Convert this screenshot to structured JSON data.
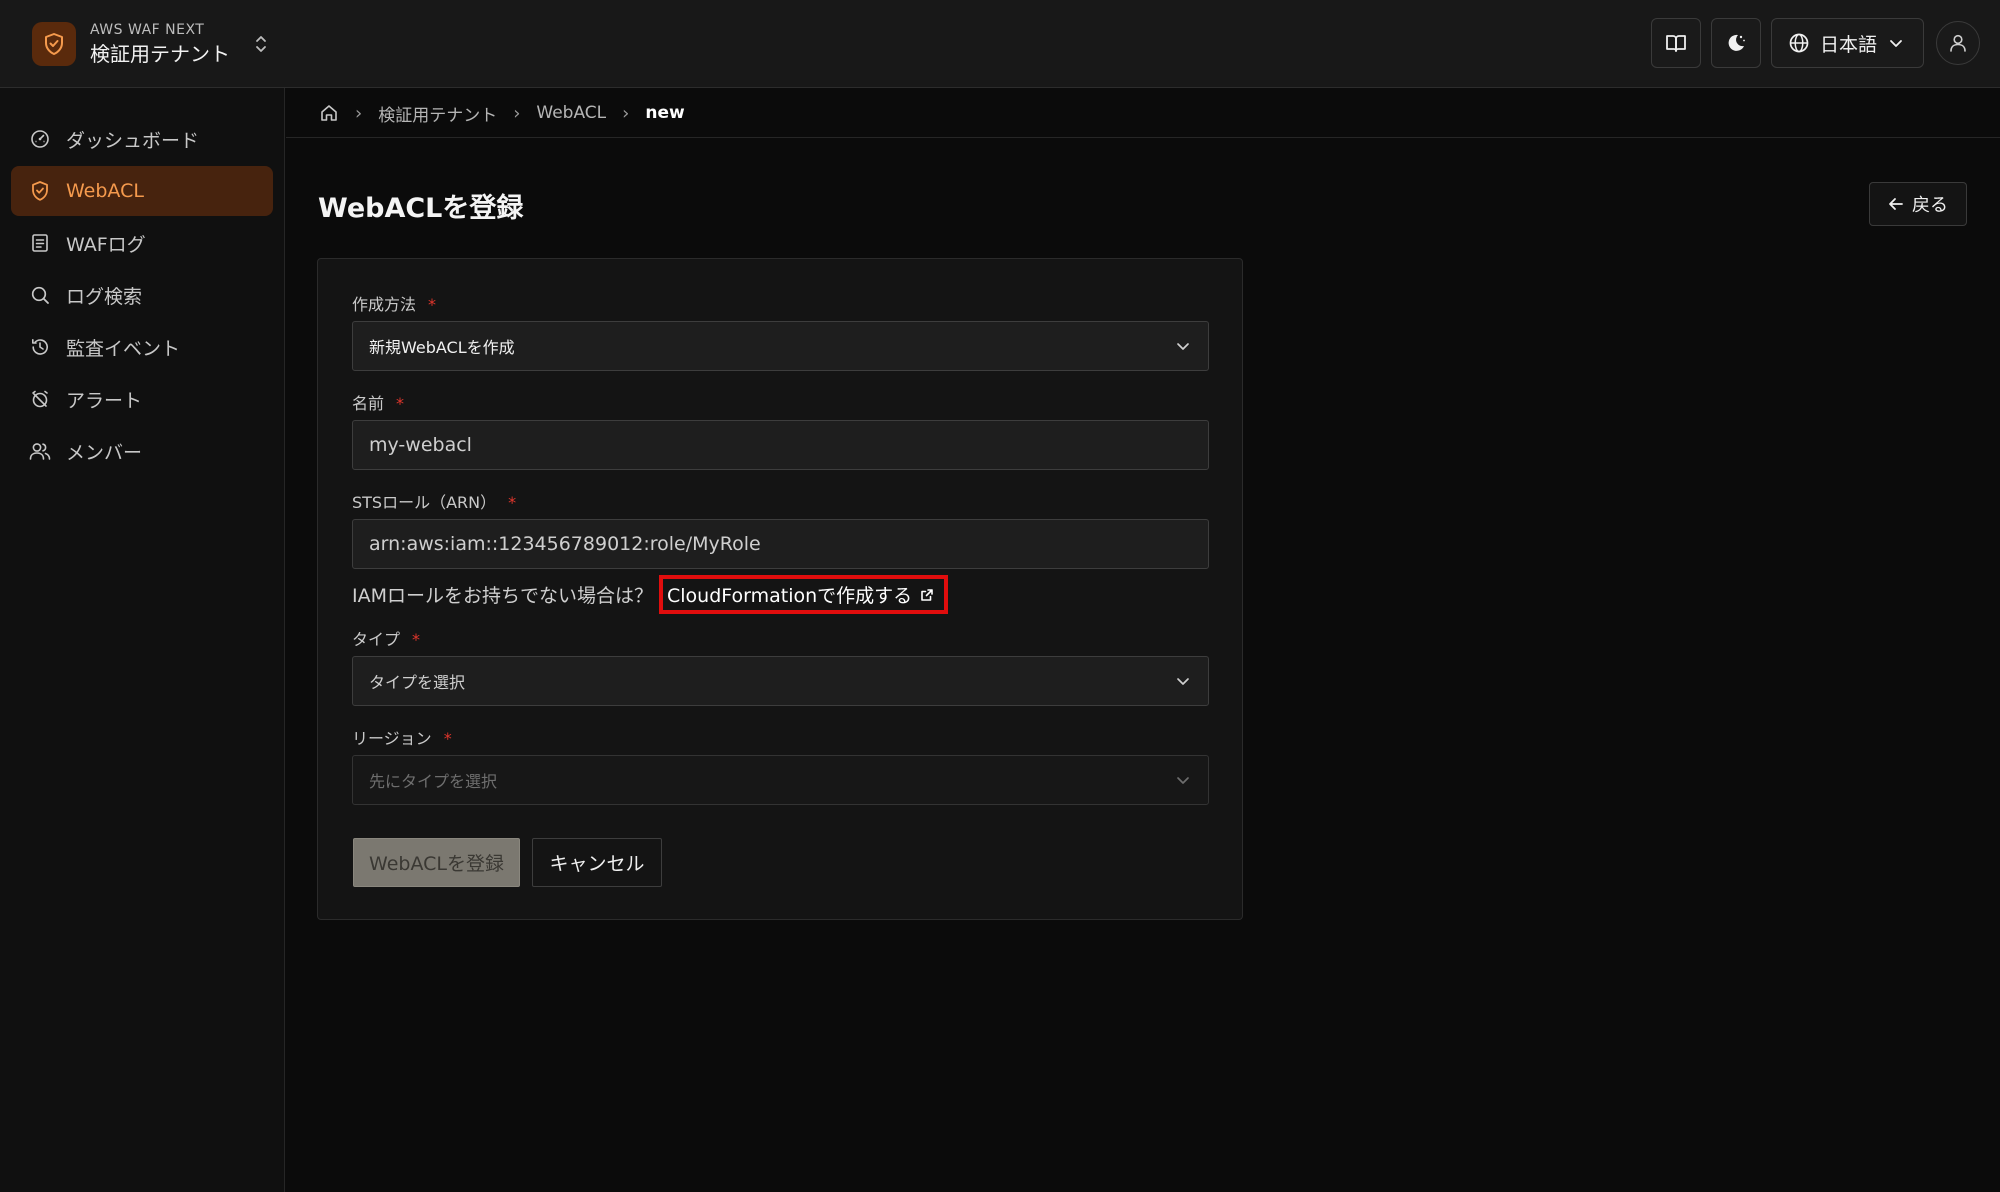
{
  "app": {
    "product_name": "AWS WAF NEXT",
    "tenant_name": "検証用テナント"
  },
  "topbar": {
    "language": "日本語"
  },
  "sidebar": {
    "items": [
      {
        "label": "ダッシュボード",
        "icon": "gauge-icon"
      },
      {
        "label": "WebACL",
        "icon": "shield-check-icon",
        "active": true
      },
      {
        "label": "WAFログ",
        "icon": "document-list-icon"
      },
      {
        "label": "ログ検索",
        "icon": "search-icon"
      },
      {
        "label": "監査イベント",
        "icon": "history-icon"
      },
      {
        "label": "アラート",
        "icon": "alarm-off-icon"
      },
      {
        "label": "メンバー",
        "icon": "users-icon"
      }
    ]
  },
  "breadcrumb": {
    "items": [
      "検証用テナント",
      "WebACL"
    ],
    "current": "new"
  },
  "page": {
    "title": "WebACLを登録",
    "back_label": "戻る"
  },
  "form": {
    "method": {
      "label": "作成方法",
      "required_mark": "*",
      "value": "新規WebACLを作成"
    },
    "name": {
      "label": "名前",
      "required_mark": "*",
      "value": "my-webacl"
    },
    "sts_role": {
      "label": "STSロール（ARN）",
      "required_mark": "*",
      "value": "arn:aws:iam::123456789012:role/MyRole"
    },
    "iam_hint": {
      "text": "IAMロールをお持ちでない場合は？",
      "link_label": "CloudFormationで作成する"
    },
    "type": {
      "label": "タイプ",
      "required_mark": "*",
      "placeholder": "タイプを選択"
    },
    "region": {
      "label": "リージョン",
      "required_mark": "*",
      "placeholder": "先にタイプを選択"
    },
    "submit_label": "WebACLを登録",
    "cancel_label": "キャンセル"
  },
  "colors": {
    "accent": "#f59a4d",
    "active_bg": "#47230e",
    "required": "#e0362c",
    "highlight_box": "#e00d0d"
  }
}
